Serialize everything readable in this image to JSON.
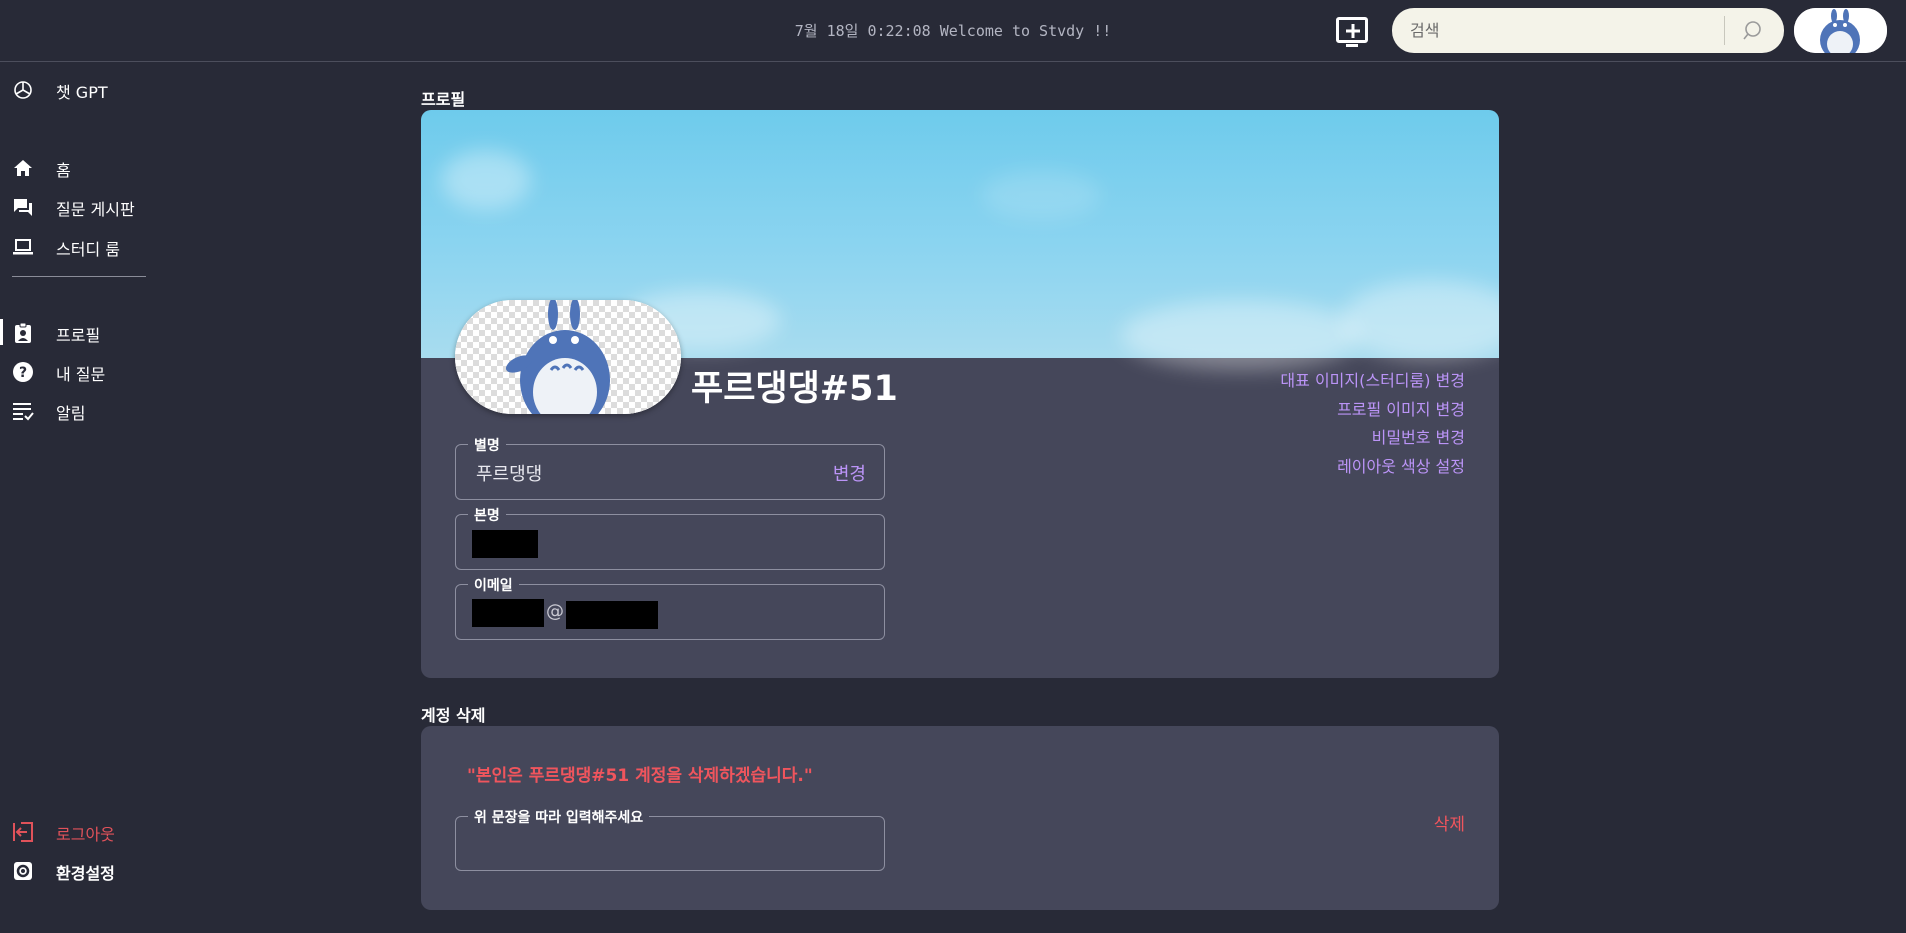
{
  "header": {
    "clock_text": "7월 18일 0:22:08 Welcome to Stvdy !!",
    "search_placeholder": "검색"
  },
  "sidebar": {
    "chat_gpt": "챗 GPT",
    "items": [
      {
        "label": "홈",
        "icon": "home-icon"
      },
      {
        "label": "질문 게시판",
        "icon": "forum-icon"
      },
      {
        "label": "스터디 룸",
        "icon": "laptop-icon"
      },
      {
        "label": "프로필",
        "icon": "profile-badge-icon",
        "active": true
      },
      {
        "label": "내 질문",
        "icon": "question-icon"
      },
      {
        "label": "알림",
        "icon": "checklist-icon"
      }
    ],
    "logout": "로그아웃",
    "settings": "환경설정"
  },
  "profile": {
    "section_title": "프로필",
    "name": "푸르댕댕#51",
    "actions": {
      "banner_image": "대표 이미지(스터디룸) 변경",
      "profile_image": "프로필 이미지 변경",
      "password": "비밀번호 변경",
      "layout_color": "레이아웃 색상 설정"
    },
    "fields": {
      "nickname_label": "별명",
      "nickname_value": "푸르댕댕",
      "change_label": "변경",
      "realname_label": "본명",
      "email_label": "이메일",
      "email_at": "@"
    }
  },
  "delete_account": {
    "section_title": "계정 삭제",
    "confirm_sentence": "\"본인은 푸르댕댕#51 계정을 삭제하겠습니다.\"",
    "input_label": "위 문장을 따라 입력해주세요",
    "delete_button": "삭제"
  },
  "colors": {
    "background": "#282a37",
    "card": "#45475a",
    "accent": "#bb94f7",
    "danger": "#f0555d"
  }
}
